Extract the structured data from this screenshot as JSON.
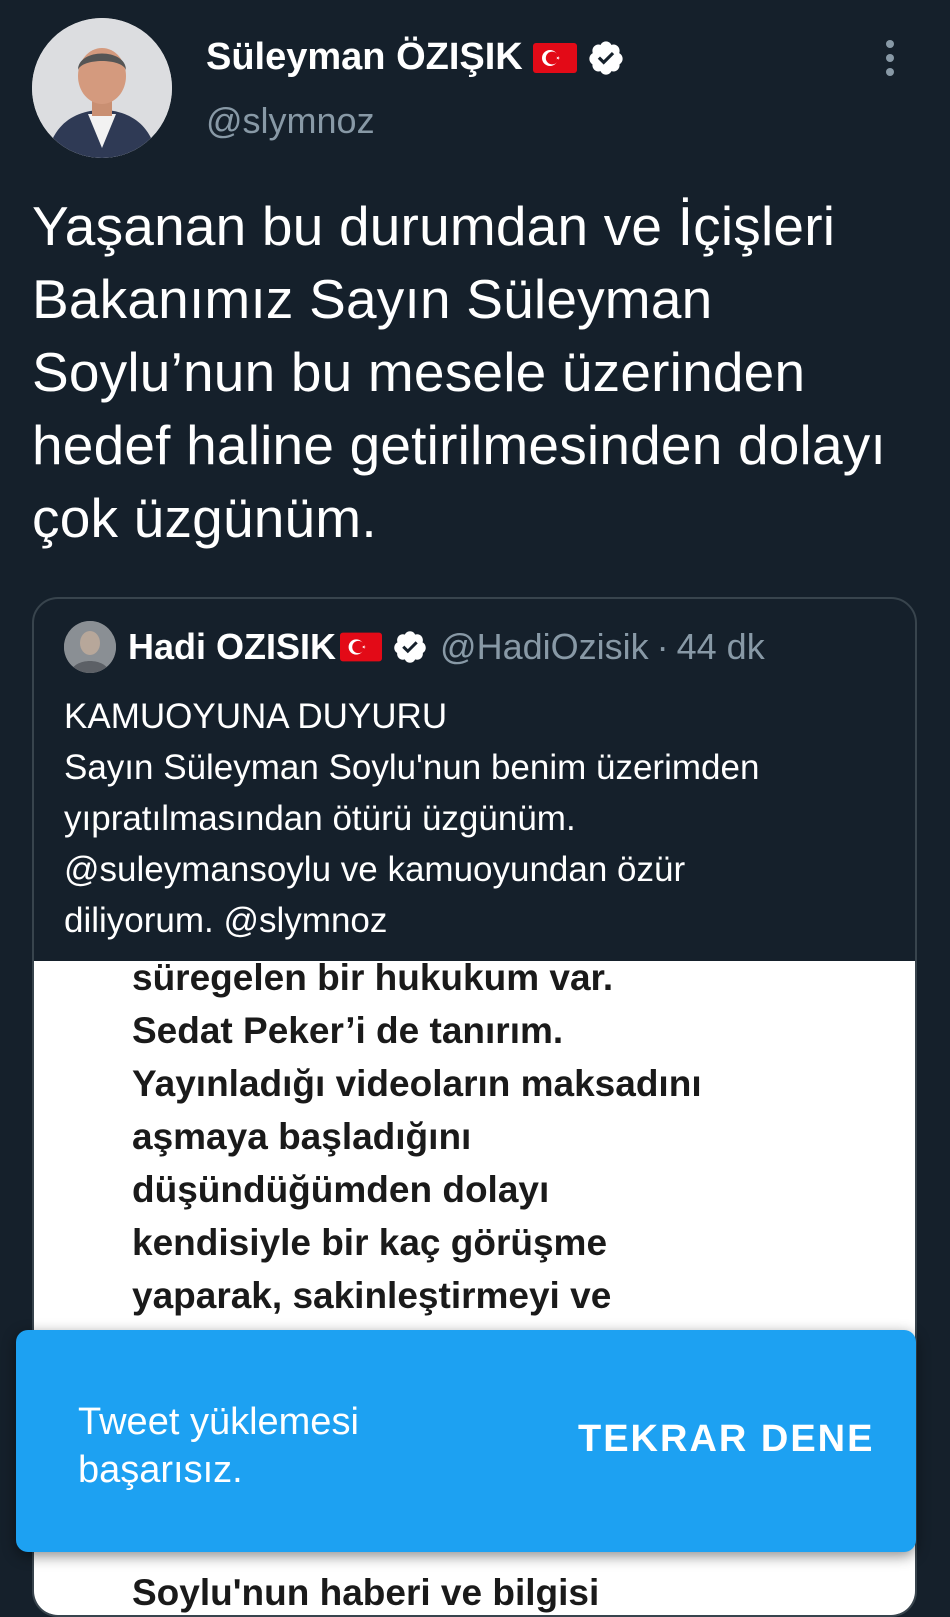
{
  "author": {
    "display_name": "Süleyman ÖZIŞIK",
    "handle": "@slymnoz",
    "flag_icon": "turkey-flag-icon",
    "verified_icon": "verified-badge-icon"
  },
  "tweet": {
    "text": "Yaşanan bu durumdan ve İçişleri Bakanımız Sayın Süleyman Soylu’nun bu mesele üzerinden hedef haline getirilmesinden dolayı çok üzgünüm."
  },
  "quoted_tweet": {
    "display_name": "Hadi OZISIK",
    "handle": "@HadiOzisik",
    "separator": "·",
    "time": "44 dk",
    "body_lines": [
      "KAMUOYUNA DUYURU",
      "Sayın Süleyman Soylu'nun benim üzerimden",
      "yıpratılmasından ötürü üzgünüm.",
      "@suleymansoylu ve kamuoyundan özür",
      "diliyorum. @slymnoz"
    ],
    "image_text_lines": [
      "süregelen bir hukukum var.",
      "Sedat Peker’i de tanırım.",
      "Yayınladığı videoların maksadını",
      "aşmaya başladığını",
      "düşündüğümden dolayı",
      "kendisiyle bir kaç görüşme",
      "yaparak, sakinleştirmeyi ve"
    ],
    "image_text_bottom": "Soylu'nun haberi ve bilgisi"
  },
  "toast": {
    "message": "Tweet yüklemesi başarısız.",
    "action_label": "TEKRAR DENE"
  },
  "colors": {
    "background": "#15202b",
    "toast": "#1da1f2",
    "secondary_text": "#8899a6",
    "flag_red": "#e30a17"
  }
}
